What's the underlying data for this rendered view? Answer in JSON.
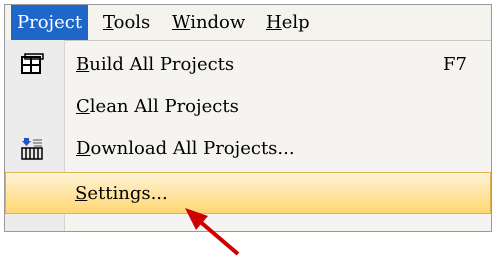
{
  "menubar": {
    "items": [
      {
        "label": "Project",
        "active": true
      },
      {
        "label": "Tools",
        "mnemonic": "T"
      },
      {
        "label": "Window",
        "mnemonic": "W"
      },
      {
        "label": "Help",
        "mnemonic": "H"
      }
    ]
  },
  "dropdown": {
    "items": [
      {
        "label": "Build All Projects",
        "mnemonic": "B",
        "shortcut": "F7",
        "icon": "build-all-icon"
      },
      {
        "label": "Clean All Projects",
        "mnemonic": "C"
      },
      {
        "label": "Download All Projects...",
        "mnemonic": "D",
        "icon": "download-icon"
      },
      {
        "label": "Settings...",
        "mnemonic": "S",
        "highlighted": true
      }
    ]
  },
  "annotation": {
    "type": "red-arrow",
    "points_to": "Settings...",
    "color": "#cc0000"
  },
  "colors": {
    "menu_active_bg": "#1e67c8",
    "highlight_bg": "#ffd773"
  }
}
